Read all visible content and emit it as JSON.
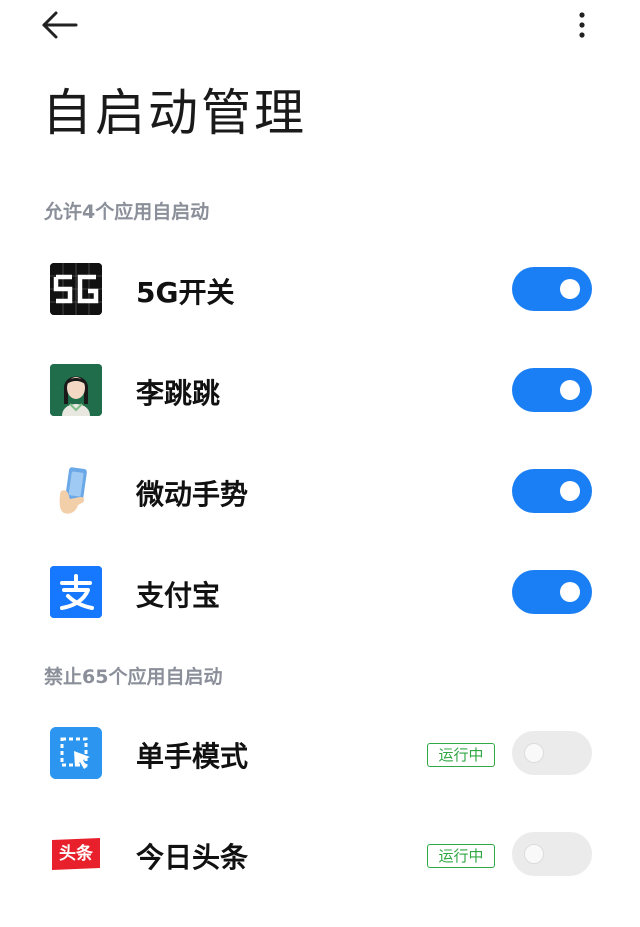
{
  "header": {
    "title": "自启动管理",
    "back_icon": "arrow-left-icon",
    "more_icon": "more-vertical-icon"
  },
  "allowed_section": {
    "label": "允许4个应用自启动",
    "apps": [
      {
        "name": "5G开关",
        "icon": "5g-icon",
        "enabled": true
      },
      {
        "name": "李跳跳",
        "icon": "girl-avatar-icon",
        "enabled": true
      },
      {
        "name": "微动手势",
        "icon": "hand-phone-icon",
        "enabled": true
      },
      {
        "name": "支付宝",
        "icon": "alipay-icon",
        "enabled": true
      }
    ]
  },
  "blocked_section": {
    "label": "禁止65个应用自启动",
    "apps": [
      {
        "name": "单手模式",
        "icon": "one-hand-mode-icon",
        "running": "运行中",
        "enabled": false
      },
      {
        "name": "今日头条",
        "icon": "toutiao-icon",
        "icon_text": "头条",
        "running": "运行中",
        "enabled": false
      }
    ]
  },
  "colors": {
    "accent": "#1a7ff5",
    "running_badge": "#2fa845",
    "section_text": "#8a8f99",
    "toggle_off": "#ebebeb"
  }
}
